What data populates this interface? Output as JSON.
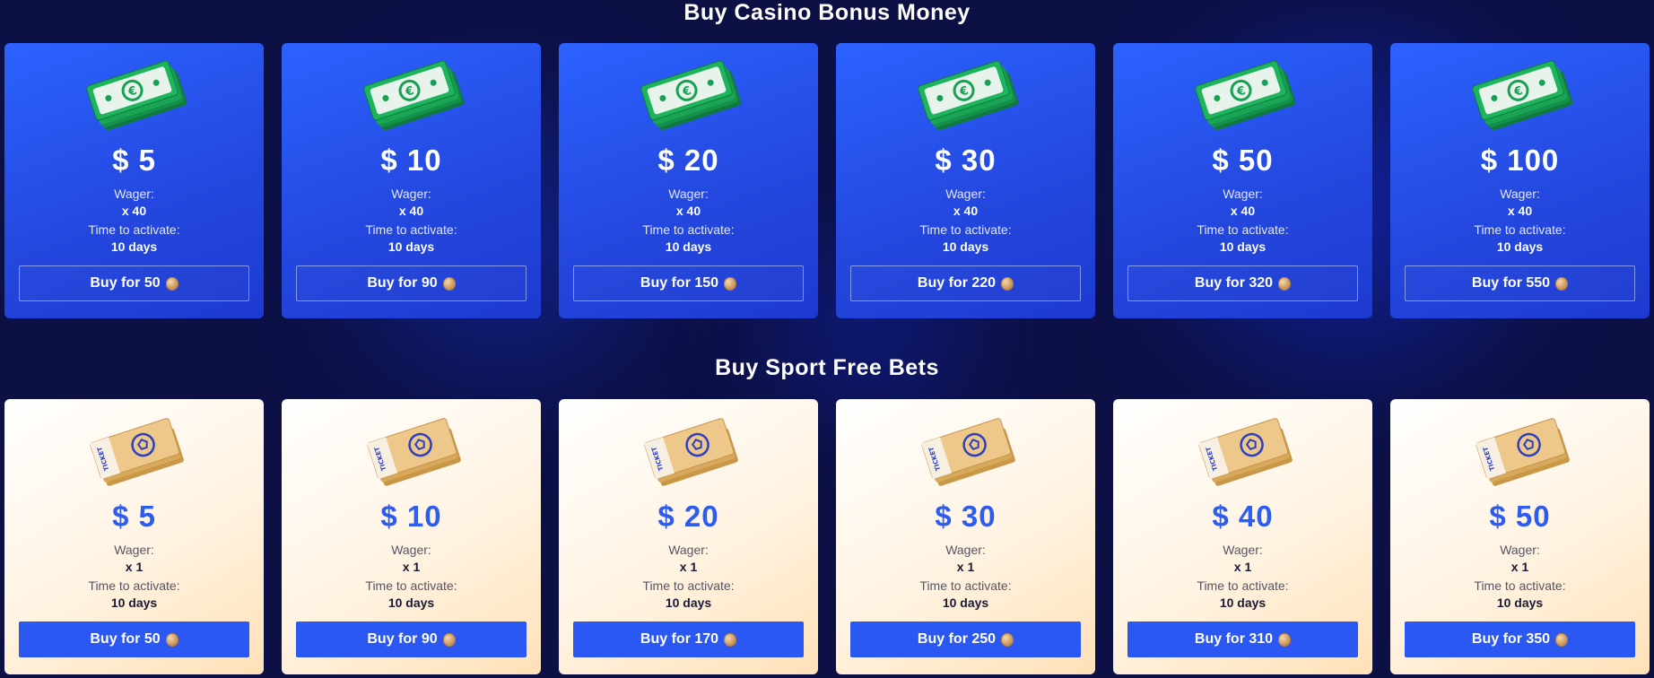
{
  "casino": {
    "title": "Buy Casino Bonus Money",
    "cards": [
      {
        "amount": "$ 5",
        "wager_label": "Wager:",
        "wager": "x 40",
        "time_label": "Time to activate:",
        "time": "10 days",
        "buy": "Buy for 50",
        "icon": "euro-cash-stack-icon"
      },
      {
        "amount": "$ 10",
        "wager_label": "Wager:",
        "wager": "x 40",
        "time_label": "Time to activate:",
        "time": "10 days",
        "buy": "Buy for 90",
        "icon": "euro-cash-stack-icon"
      },
      {
        "amount": "$ 20",
        "wager_label": "Wager:",
        "wager": "x 40",
        "time_label": "Time to activate:",
        "time": "10 days",
        "buy": "Buy for 150",
        "icon": "euro-cash-stack-icon"
      },
      {
        "amount": "$ 30",
        "wager_label": "Wager:",
        "wager": "x 40",
        "time_label": "Time to activate:",
        "time": "10 days",
        "buy": "Buy for 220",
        "icon": "euro-cash-stack-icon"
      },
      {
        "amount": "$ 50",
        "wager_label": "Wager:",
        "wager": "x 40",
        "time_label": "Time to activate:",
        "time": "10 days",
        "buy": "Buy for 320",
        "icon": "euro-cash-stack-icon"
      },
      {
        "amount": "$ 100",
        "wager_label": "Wager:",
        "wager": "x 40",
        "time_label": "Time to activate:",
        "time": "10 days",
        "buy": "Buy for 550",
        "icon": "euro-cash-stack-icon"
      }
    ]
  },
  "sport": {
    "title": "Buy Sport Free Bets",
    "cards": [
      {
        "amount": "$ 5",
        "wager_label": "Wager:",
        "wager": "x 1",
        "time_label": "Time to activate:",
        "time": "10 days",
        "buy": "Buy for 50",
        "icon": "ticket-stack-icon"
      },
      {
        "amount": "$ 10",
        "wager_label": "Wager:",
        "wager": "x 1",
        "time_label": "Time to activate:",
        "time": "10 days",
        "buy": "Buy for 90",
        "icon": "ticket-stack-icon"
      },
      {
        "amount": "$ 20",
        "wager_label": "Wager:",
        "wager": "x 1",
        "time_label": "Time to activate:",
        "time": "10 days",
        "buy": "Buy for 170",
        "icon": "ticket-stack-icon"
      },
      {
        "amount": "$ 30",
        "wager_label": "Wager:",
        "wager": "x 1",
        "time_label": "Time to activate:",
        "time": "10 days",
        "buy": "Buy for 250",
        "icon": "ticket-stack-icon"
      },
      {
        "amount": "$ 40",
        "wager_label": "Wager:",
        "wager": "x 1",
        "time_label": "Time to activate:",
        "time": "10 days",
        "buy": "Buy for 310",
        "icon": "ticket-stack-icon"
      },
      {
        "amount": "$ 50",
        "wager_label": "Wager:",
        "wager": "x 1",
        "time_label": "Time to activate:",
        "time": "10 days",
        "buy": "Buy for 350",
        "icon": "ticket-stack-icon"
      }
    ]
  },
  "colors": {
    "page_background": "#0c1045",
    "casino_card": "#2c62ff",
    "sport_card": "#fff3e2",
    "sport_button": "#2b58f2",
    "sport_amount": "#2d5cf0"
  },
  "icons": {
    "coin": "coin-icon"
  },
  "ticket_stamp_text": "TICKET"
}
